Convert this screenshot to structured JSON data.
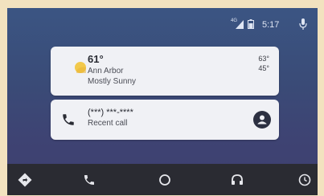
{
  "status": {
    "network_label": "4G",
    "time": "5:17"
  },
  "weather": {
    "temperature": "61°",
    "location": "Ann Arbor",
    "condition": "Mostly Sunny",
    "high": "63°",
    "low": "45°"
  },
  "call": {
    "number": "(***) ***-****",
    "label": "Recent call"
  },
  "navbar": {
    "items": [
      "navigation",
      "phone",
      "home",
      "audio",
      "recents"
    ]
  },
  "colors": {
    "background": "#f2e2bf",
    "screen_top": "#3b5583",
    "screen_bottom": "#3f3f6e",
    "card": "#f0f1f5",
    "navbar": "#2a2b32",
    "sun": "#f2c94c"
  }
}
